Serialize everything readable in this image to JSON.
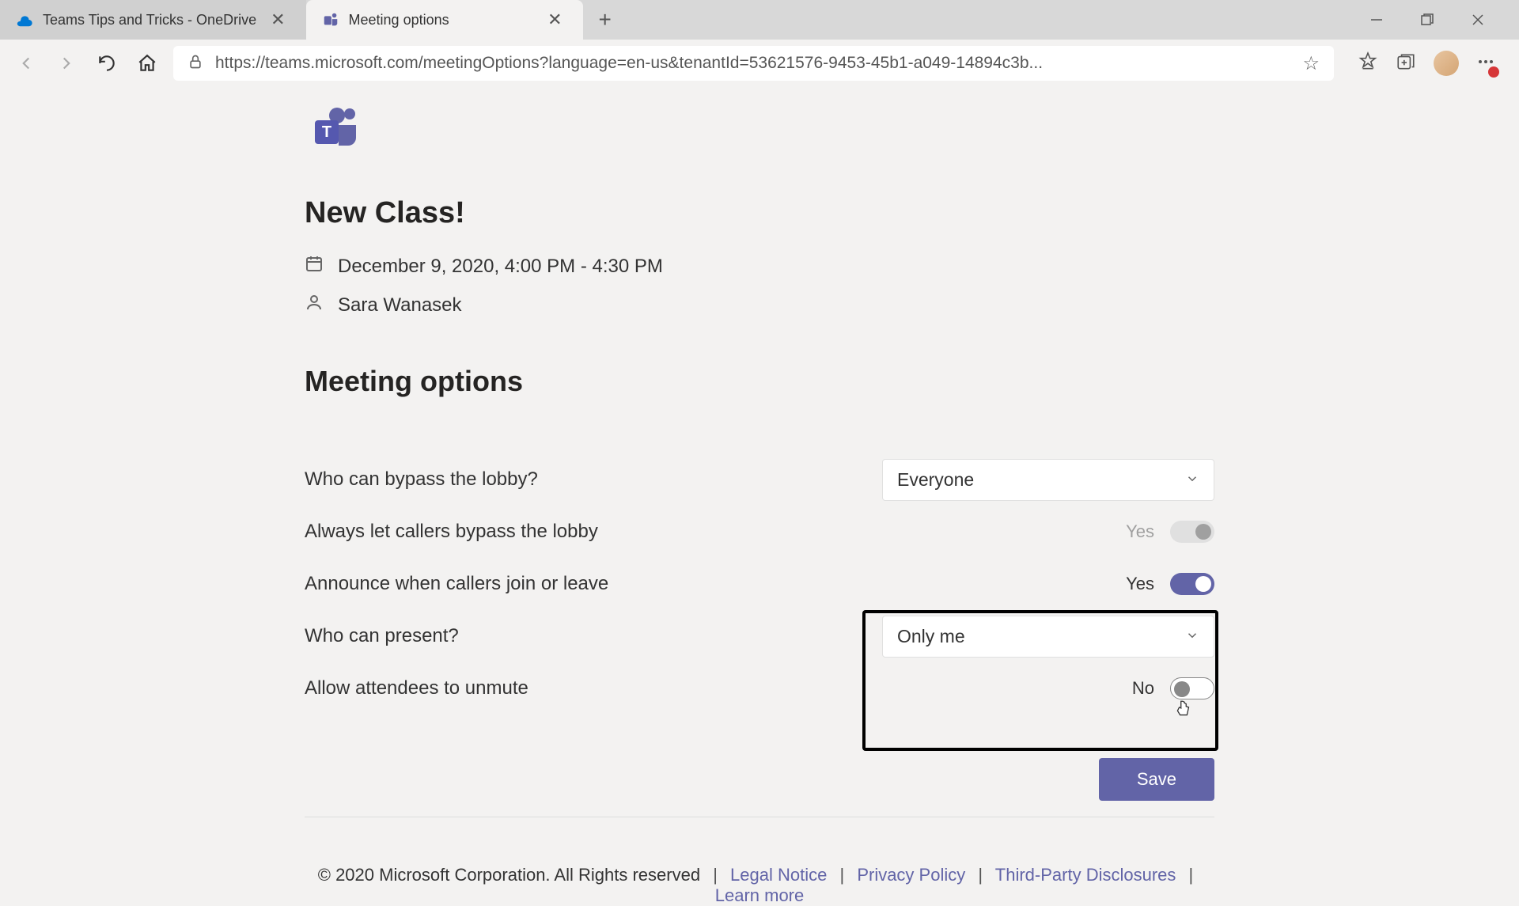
{
  "browser": {
    "tabs": [
      {
        "title": "Teams Tips and Tricks - OneDrive",
        "active": false,
        "icon": "onedrive"
      },
      {
        "title": "Meeting options",
        "active": true,
        "icon": "teams"
      }
    ],
    "url": "https://teams.microsoft.com/meetingOptions?language=en-us&tenantId=53621576-9453-45b1-a049-14894c3b..."
  },
  "meeting": {
    "title": "New Class!",
    "datetime": "December 9, 2020, 4:00 PM - 4:30 PM",
    "organizer": "Sara Wanasek"
  },
  "section_title": "Meeting options",
  "options": {
    "bypass_lobby": {
      "label": "Who can bypass the lobby?",
      "value": "Everyone"
    },
    "always_bypass": {
      "label": "Always let callers bypass the lobby",
      "value": "Yes",
      "state": "disabled"
    },
    "announce": {
      "label": "Announce when callers join or leave",
      "value": "Yes",
      "state": "on"
    },
    "who_present": {
      "label": "Who can present?",
      "value": "Only me"
    },
    "allow_unmute": {
      "label": "Allow attendees to unmute",
      "value": "No",
      "state": "off"
    }
  },
  "save_label": "Save",
  "footer": {
    "copyright": "© 2020 Microsoft Corporation. All Rights reserved",
    "links": [
      "Legal Notice",
      "Privacy Policy",
      "Third-Party Disclosures",
      "Learn more"
    ]
  },
  "colors": {
    "accent": "#6264a7"
  }
}
